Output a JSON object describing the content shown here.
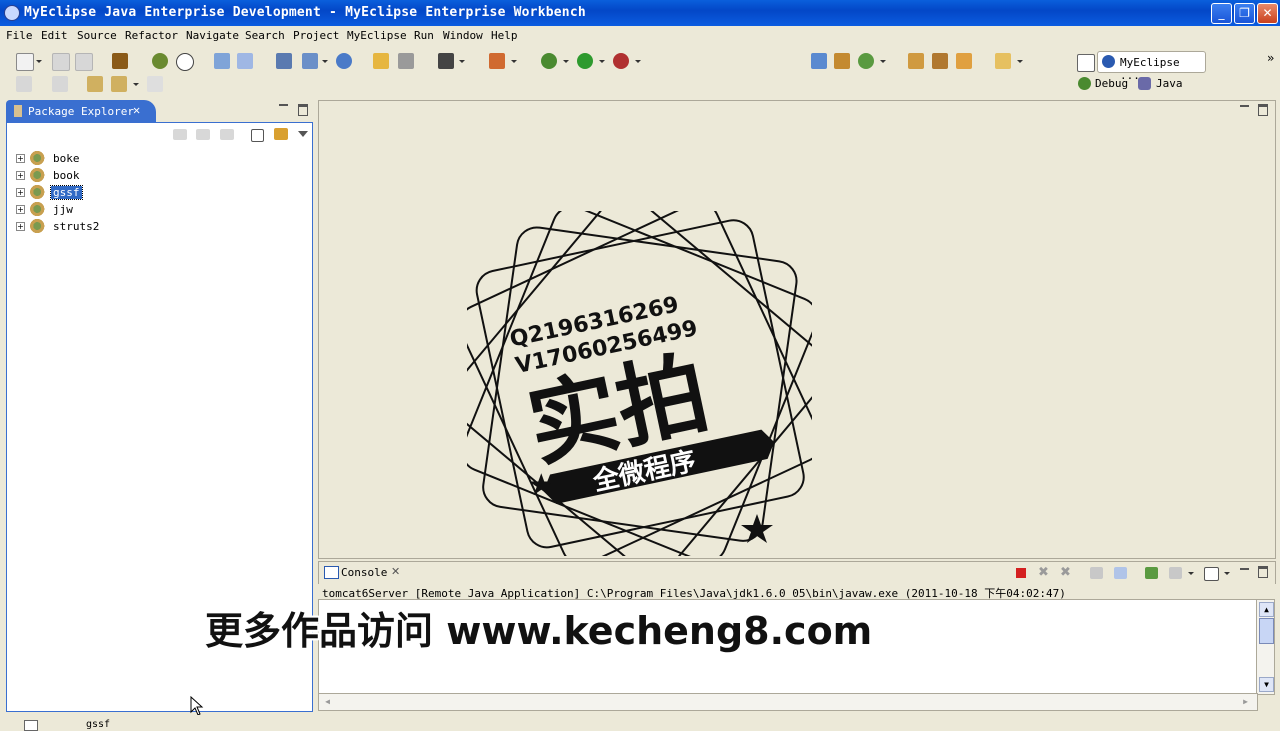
{
  "window": {
    "title": "MyEclipse Java Enterprise Development - MyEclipse Enterprise Workbench"
  },
  "menu": [
    "File",
    "Edit",
    "Source",
    "Refactor",
    "Navigate",
    "Search",
    "Project",
    "MyEclipse",
    "Run",
    "Window",
    "Help"
  ],
  "perspectives": {
    "current": "MyEclipse ...",
    "debug": "Debug",
    "java": "Java"
  },
  "package_explorer": {
    "title": "Package Explorer",
    "projects": [
      {
        "name": "boke",
        "selected": false
      },
      {
        "name": "book",
        "selected": false
      },
      {
        "name": "gssf",
        "selected": true
      },
      {
        "name": "jjw",
        "selected": false
      },
      {
        "name": "struts2",
        "selected": false
      }
    ]
  },
  "stamp": {
    "line1": "Q2196316269",
    "line2": "V17060256499",
    "big": "实拍",
    "banner": "全微程序"
  },
  "console": {
    "title": "Console",
    "header": "tomcat6Server [Remote Java Application] C:\\Program Files\\Java\\jdk1.6.0_05\\bin\\javaw.exe (2011-10-18 下午04:02:47)"
  },
  "watermark": "更多作品访问 www.kecheng8.com",
  "status": {
    "text": "gssf"
  },
  "colors": {
    "titlebar": "#0347c7",
    "selection": "#316ac5",
    "tab_active": "#3a6fd0",
    "stop_red": "#d42020"
  }
}
